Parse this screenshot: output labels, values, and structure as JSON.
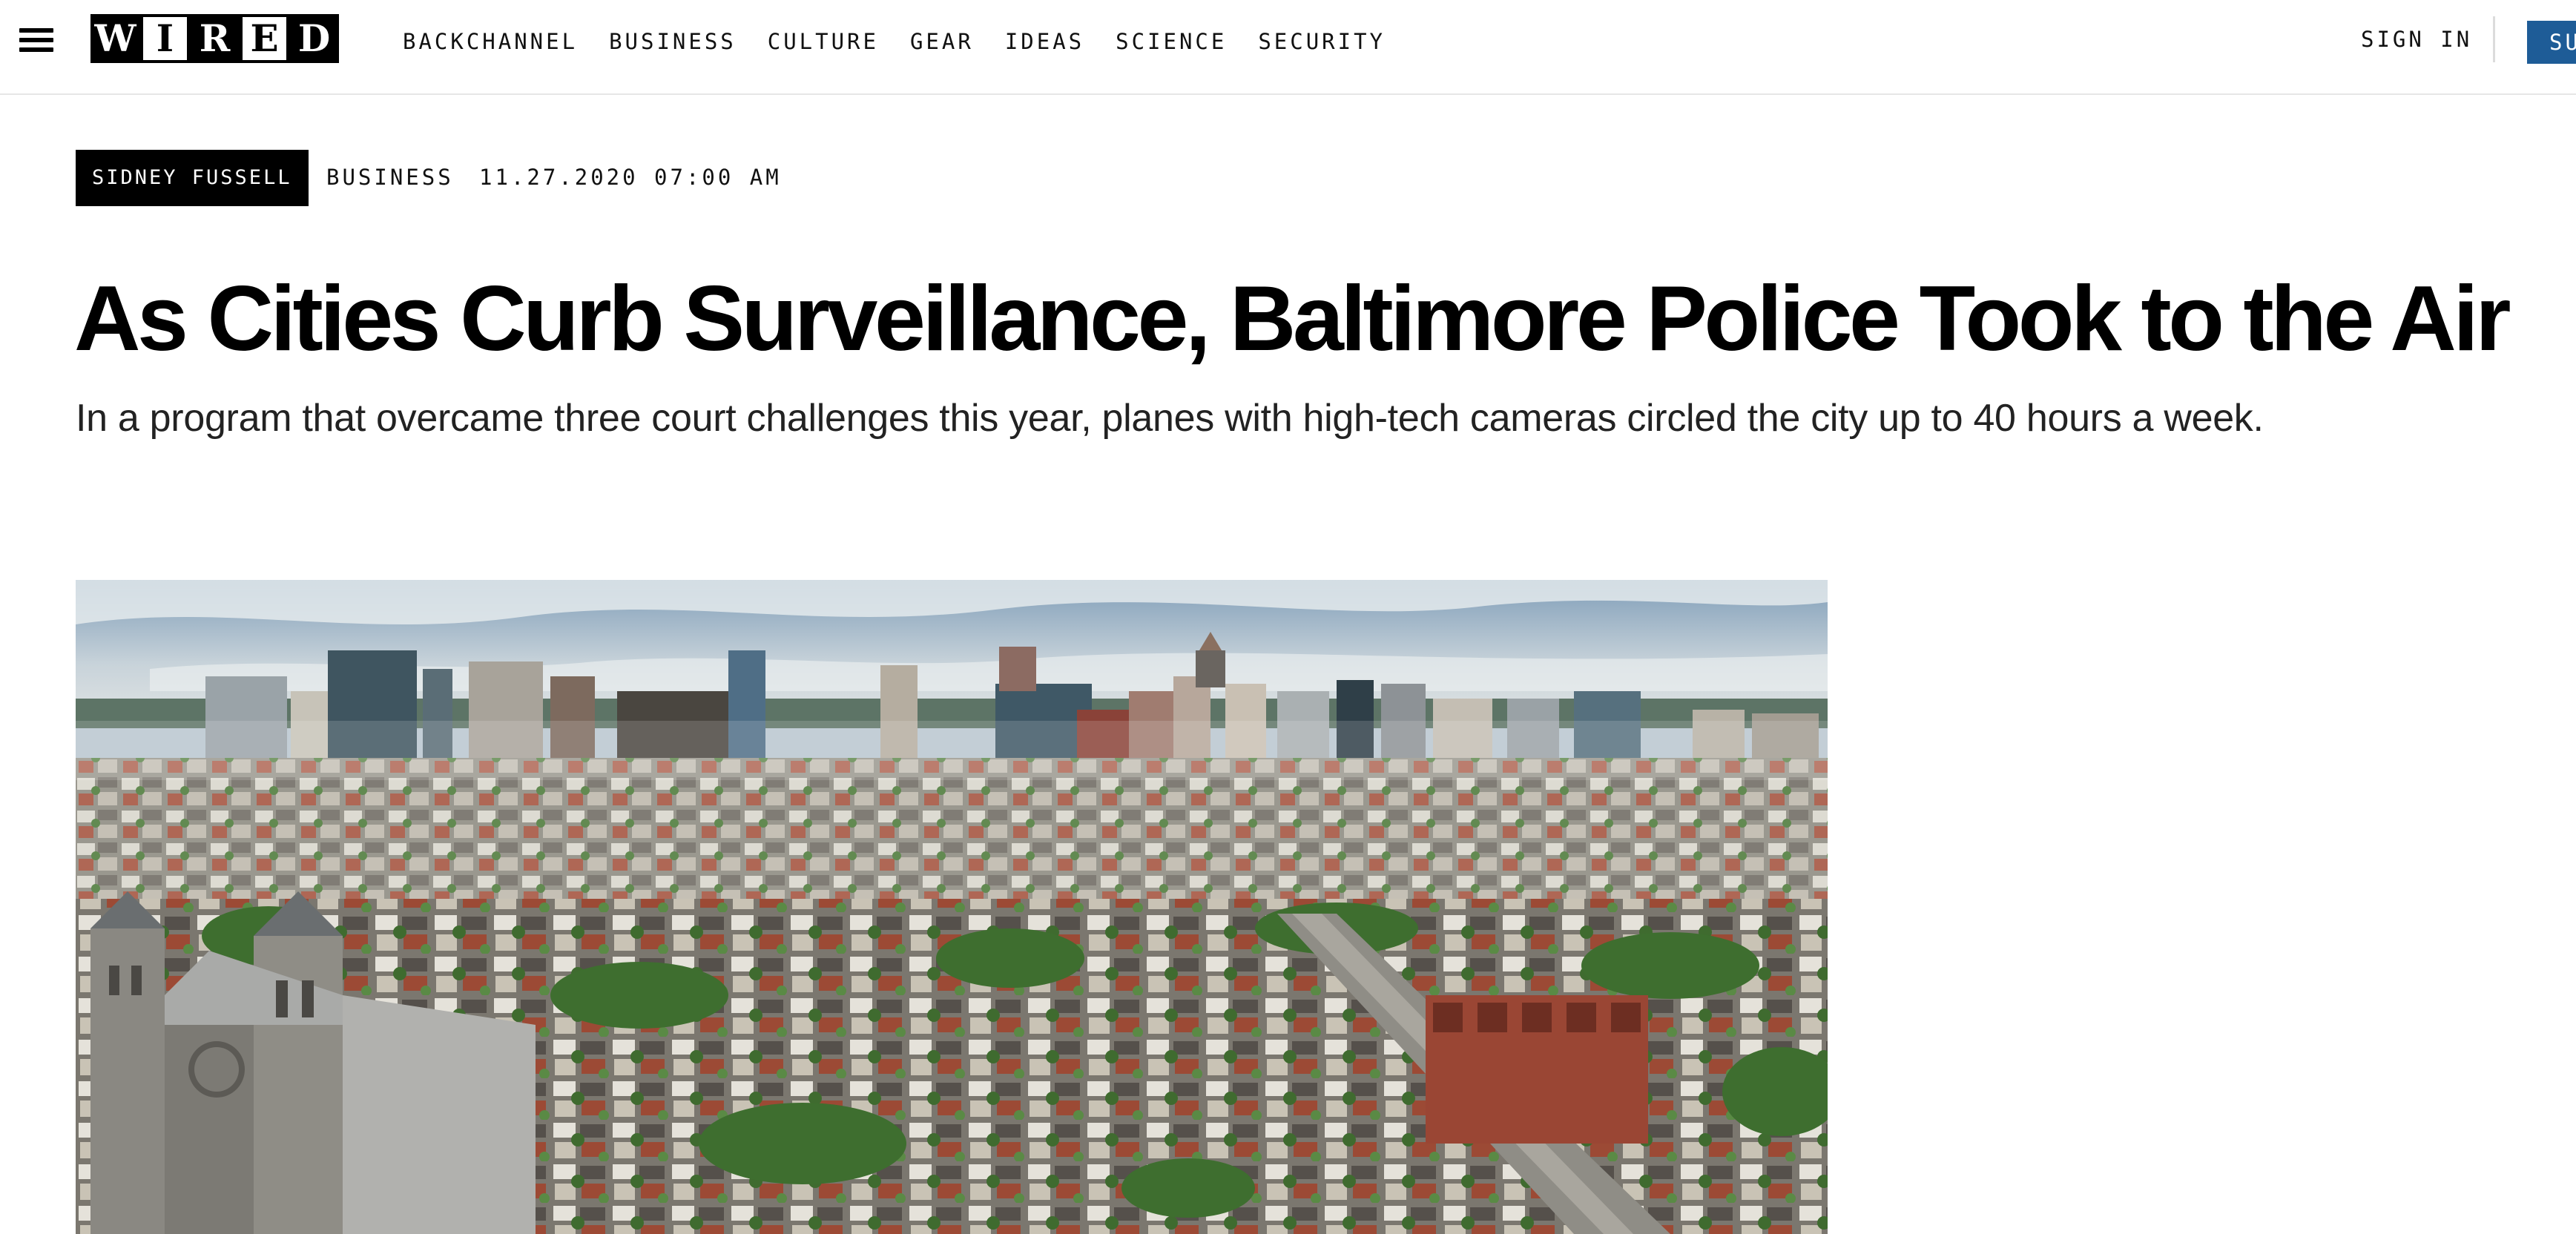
{
  "header": {
    "logo_letters": [
      "W",
      "I",
      "R",
      "E",
      "D"
    ],
    "nav_items": [
      "BACKCHANNEL",
      "BUSINESS",
      "CULTURE",
      "GEAR",
      "IDEAS",
      "SCIENCE",
      "SECURITY"
    ],
    "sign_in_label": "SIGN IN",
    "subscribe_label": "SU",
    "menu_icon": "hamburger-menu-icon"
  },
  "article": {
    "author": "SIDNEY FUSSELL",
    "section": "BUSINESS",
    "published": "11.27.2020 07:00 AM",
    "headline": "As Cities Curb Surveillance, Baltimore Police Took to the Air",
    "dek": "In a program that overcame three court challenges this year, planes with high-tech cameras circled the city up to 40 hours a week."
  },
  "colors": {
    "subscribe_bg": "#1e5c97",
    "author_tag_bg": "#000000",
    "text": "#000000"
  }
}
